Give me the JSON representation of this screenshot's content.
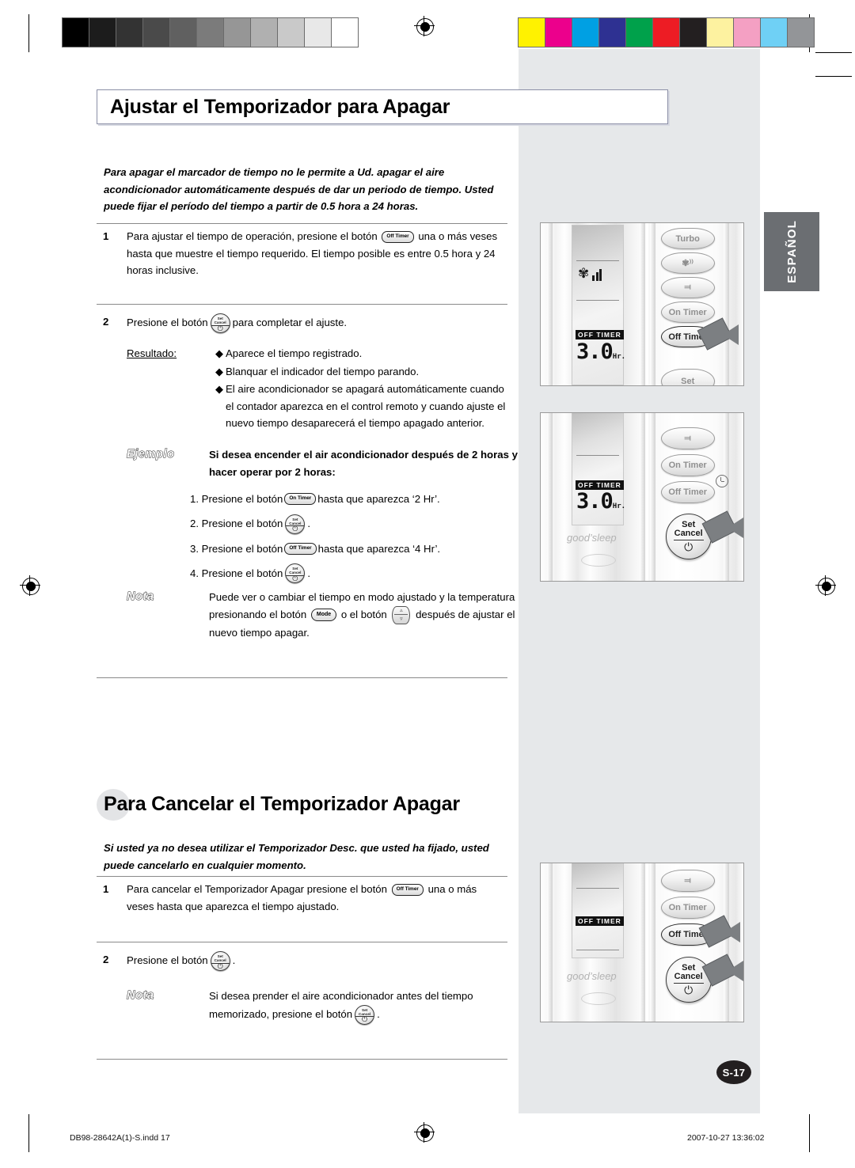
{
  "page": {
    "language_tab": "ESPAÑOL",
    "page_badge": "S-17",
    "footer_file": "DB98-28642A(1)-S.indd   17",
    "footer_date": "2007-10-27   13:36:02"
  },
  "section1": {
    "title": "Ajustar el Temporizador para Apagar",
    "intro": "Para apagar el marcador de tiempo no le permite a Ud. apagar el aire acondicionador automáticamente después de dar un periodo de tiempo. Usted puede fijar el período del tiempo a partir de 0.5 hora a 24 horas.",
    "step1_num": "1",
    "step1_pre": "Para ajustar el tiempo de operación, presione el botón",
    "step1_btn": "Off Timer",
    "step1_post": "una o más veses hasta que muestre el tiempo requerido. El tiempo posible es entre 0.5 hora y 24 horas inclusive.",
    "step2_num": "2",
    "step2_pre": "Presione el botón",
    "step2_btn_l1": "Set",
    "step2_btn_l2": "Cancel",
    "step2_post": "para completar el ajuste.",
    "result_label": "Resultado:",
    "result_items": [
      "Aparece el tiempo registrado.",
      "Blanquar el indicador del tiempo parando.",
      "El aire acondicionador se apagará automáticamente cuando el contador aparezca en el control remoto y cuando ajuste el nuevo tiempo desaparecerá el tiempo apagado anterior."
    ],
    "diamond": "◆",
    "example_tag": "Ejemplo",
    "example_title": "Si desea encender el air acondicionador después de 2 horas y hacer operar por 2 horas:",
    "example_steps": [
      {
        "n": "1.",
        "pre": "Presione el botón",
        "btn": "On Timer",
        "post": "hasta que aparezca ‘2 Hr’."
      },
      {
        "n": "2.",
        "pre": "Presione el botón",
        "btn": "SetCancel",
        "post": "."
      },
      {
        "n": "3.",
        "pre": "Presione el botón",
        "btn": "Off Timer",
        "post": "hasta que aparezca ‘4 Hr’."
      },
      {
        "n": "4.",
        "pre": "Presione el botón",
        "btn": "SetCancel",
        "post": "."
      }
    ],
    "note_tag": "Nota",
    "note_pre": "Puede ver o cambiar el tiempo en modo ajustado y la temperatura presionando el botón",
    "note_btn1": "Mode",
    "note_mid": "o el botón",
    "note_post": "después de ajustar el nuevo tiempo apagar."
  },
  "section2": {
    "title": "Para Cancelar el Temporizador Apagar",
    "intro": "Si usted ya no desea utilizar el Temporizador Desc. que usted ha fijado, usted puede cancelarlo en cualquier momento.",
    "step1_num": "1",
    "step1_pre": "Para cancelar el Temporizador Apagar presione el botón",
    "step1_btn": "Off Timer",
    "step1_post": "una o más veses hasta que aparezca el tiempo ajustado.",
    "step2_num": "2",
    "step2_pre": "Presione el botón",
    "step2_post": ".",
    "note_tag": "Nota",
    "note_pre": "Si desea prender el aire acondicionador antes del tiempo memorizado, presione el botón",
    "note_post": "."
  },
  "remote1": {
    "display_tag": "OFF  TIMER",
    "display_value": "3.0",
    "display_unit": "Hr.",
    "buttons": [
      "Turbo",
      "fan-speed-icon",
      "swing-icon",
      "On Timer",
      "Off Timer",
      "Set"
    ],
    "highlighted": "Off Timer"
  },
  "remote2": {
    "display_tag": "OFF  TIMER",
    "display_value": "3.0",
    "display_unit": "Hr.",
    "brand": "good’sleep",
    "buttons": [
      "swing-icon",
      "On Timer",
      "Off Timer",
      "Set Cancel"
    ],
    "set_label_1": "Set",
    "set_label_2": "Cancel",
    "highlighted": "Set Cancel"
  },
  "remote3": {
    "display_tag": "OFF  TIMER",
    "brand": "good’sleep",
    "buttons": [
      "swing-icon",
      "On Timer",
      "Off Timer",
      "Set Cancel"
    ],
    "set_label_1": "Set",
    "set_label_2": "Cancel",
    "highlighted": [
      "Off Timer",
      "Set Cancel"
    ]
  },
  "colorbars": {
    "grayscale": [
      "#000000",
      "#1c1c1c",
      "#333333",
      "#4a4a4a",
      "#606060",
      "#7b7b7b",
      "#969696",
      "#b0b0b0",
      "#c9c9c9",
      "#e8e8e8",
      "#ffffff"
    ],
    "colors": [
      "#fff200",
      "#ec008c",
      "#00a0e3",
      "#2e3192",
      "#00a14b",
      "#ed1c24",
      "#231f20",
      "#fdf2a0",
      "#f4a0c3",
      "#6fd0f5",
      "#939598"
    ]
  }
}
